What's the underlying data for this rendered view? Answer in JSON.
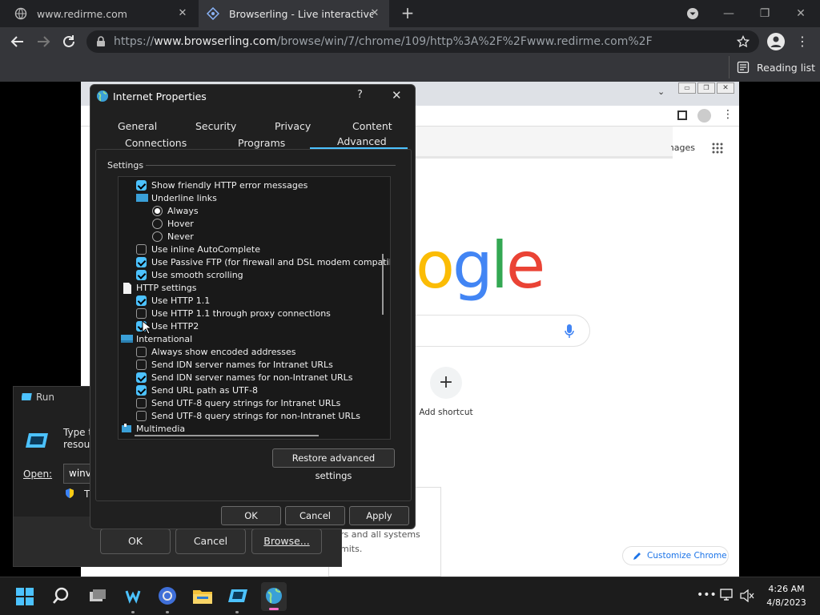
{
  "browser": {
    "tab1_title": "www.redirme.com",
    "tab2_title": "Browserling - Live interactive cross-browser testing",
    "url_prefix": "https://",
    "url_host": "www.browserling.com",
    "url_path": "/browse/win/7/chrome/109/http%3A%2F%2Fwww.redirme.com%2F",
    "reading_list": "Reading list"
  },
  "remote_chrome": {
    "images_text": "Images",
    "add_shortcut": "Add shortcut",
    "customize": "Customize Chrome",
    "notice_line1": "rs and all systems",
    "notice_line2": "mits."
  },
  "run_dialog": {
    "title": "Run",
    "prompt_line1": "Type th",
    "prompt_line2": "resour",
    "open_label": "Open:",
    "open_value": "winve",
    "admin_note": "Th",
    "ok": "OK",
    "cancel": "Cancel",
    "browse": "Browse..."
  },
  "ip_dialog": {
    "title": "Internet Properties",
    "help": "?",
    "tabs_row1": [
      "General",
      "Security",
      "Privacy",
      "Content"
    ],
    "tabs_row2": [
      "Connections",
      "Programs",
      "Advanced"
    ],
    "settings_label": "Settings",
    "items": [
      {
        "kind": "check",
        "checked": true,
        "label": "Show friendly HTTP error messages",
        "indent": 1
      },
      {
        "kind": "group",
        "icon": "underline-links-icon",
        "label": "Underline links",
        "indent": 1
      },
      {
        "kind": "radio",
        "checked": true,
        "label": "Always",
        "indent": 2
      },
      {
        "kind": "radio",
        "checked": false,
        "label": "Hover",
        "indent": 2
      },
      {
        "kind": "radio",
        "checked": false,
        "label": "Never",
        "indent": 2
      },
      {
        "kind": "check",
        "checked": false,
        "label": "Use inline AutoComplete",
        "indent": 1
      },
      {
        "kind": "check",
        "checked": true,
        "label": "Use Passive FTP (for firewall and DSL modem compatibility",
        "indent": 1
      },
      {
        "kind": "check",
        "checked": true,
        "label": "Use smooth scrolling",
        "indent": 1
      },
      {
        "kind": "group",
        "icon": "page-icon",
        "label": "HTTP settings",
        "indent": 0
      },
      {
        "kind": "check",
        "checked": true,
        "label": "Use HTTP 1.1",
        "indent": 1
      },
      {
        "kind": "check",
        "checked": false,
        "label": "Use HTTP 1.1 through proxy connections",
        "indent": 1
      },
      {
        "kind": "check",
        "checked": true,
        "label": "Use HTTP2",
        "indent": 1
      },
      {
        "kind": "group",
        "icon": "globe-folder-icon",
        "label": "International",
        "indent": 0
      },
      {
        "kind": "check",
        "checked": false,
        "label": "Always show encoded addresses",
        "indent": 1
      },
      {
        "kind": "check",
        "checked": false,
        "label": "Send IDN server names for Intranet URLs",
        "indent": 1
      },
      {
        "kind": "check",
        "checked": true,
        "label": "Send IDN server names for non-Intranet URLs",
        "indent": 1
      },
      {
        "kind": "check",
        "checked": true,
        "label": "Send URL path as UTF-8",
        "indent": 1
      },
      {
        "kind": "check",
        "checked": false,
        "label": "Send UTF-8 query strings for Intranet URLs",
        "indent": 1
      },
      {
        "kind": "check",
        "checked": false,
        "label": "Send UTF-8 query strings for non-Intranet URLs",
        "indent": 1
      },
      {
        "kind": "group",
        "icon": "multimedia-icon",
        "label": "Multimedia",
        "indent": 0
      }
    ],
    "restore_button": "Restore advanced settings",
    "ok": "OK",
    "cancel": "Cancel",
    "apply": "Apply"
  },
  "taskbar": {
    "time": "4:26 AM",
    "date": "4/8/2023"
  },
  "colors": {
    "accent": "#4cc2ff",
    "dialog_bg": "#202020",
    "taskbar": "#1c1c1c"
  }
}
